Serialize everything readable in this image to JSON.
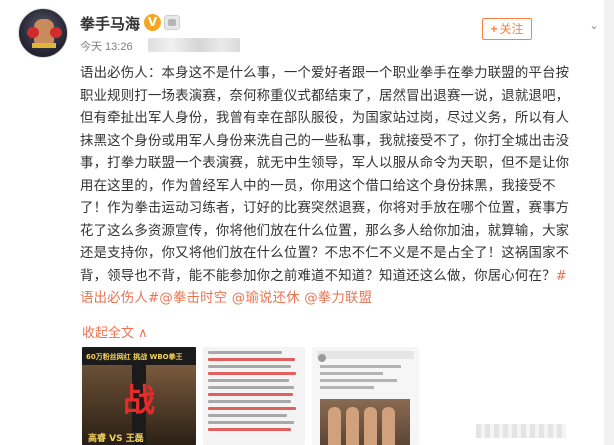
{
  "post": {
    "author": "拳手马海",
    "time": "今天 13:26",
    "follow_plus": "+",
    "follow_label": "关注",
    "body": "语出必伤人：本身这不是什么事，一个爱好者跟一个职业拳手在拳力联盟的平台按职业规则打一场表演赛，奈何称重仪式都结束了，居然冒出退赛一说，退就退吧，但有牵扯出军人身份，我曾有幸在部队服役，为国家站过岗，尽过义务，所以有人抹黑这个身份或用军人身份来洗自己的一些私事，我就接受不了，你打全城出击没事，打拳力联盟一个表演赛，就无中生领导，军人以服从命令为天职，但不是让你用在这里的，作为曾经军人中的一员，你用这个借口给这个身份抹黑，我接受不了！作为拳击运动习练者，订好的比赛突然退赛，你将对手放在哪个位置，赛事方花了这么多资源宣传，你将他们放在什么位置，那么多人给你加油，就算输，大家还是支持你，你又将他们放在什么位置？不忠不仁不义是不是占全了！这祸国家不背，领导也不背，能不能参加你之前难道不知道？知道还这么做，你居心何在？",
    "tags": [
      "#语出必伤人#",
      "@拳击时空",
      "@瑜说还休",
      "@拳力联盟"
    ],
    "collapse_label": "收起全文",
    "collapse_arrow": "∧",
    "verified_mark": "V",
    "expand_icon": "⌄"
  },
  "images": {
    "poster_title": "60万粉丝网红 挑战 WBO拳王",
    "poster_mark": "战",
    "poster_bottom": "高睿 VS 王磊"
  },
  "colors": {
    "accent": "#eb7350",
    "follow": "#ff8140",
    "verified": "#f6a623"
  }
}
